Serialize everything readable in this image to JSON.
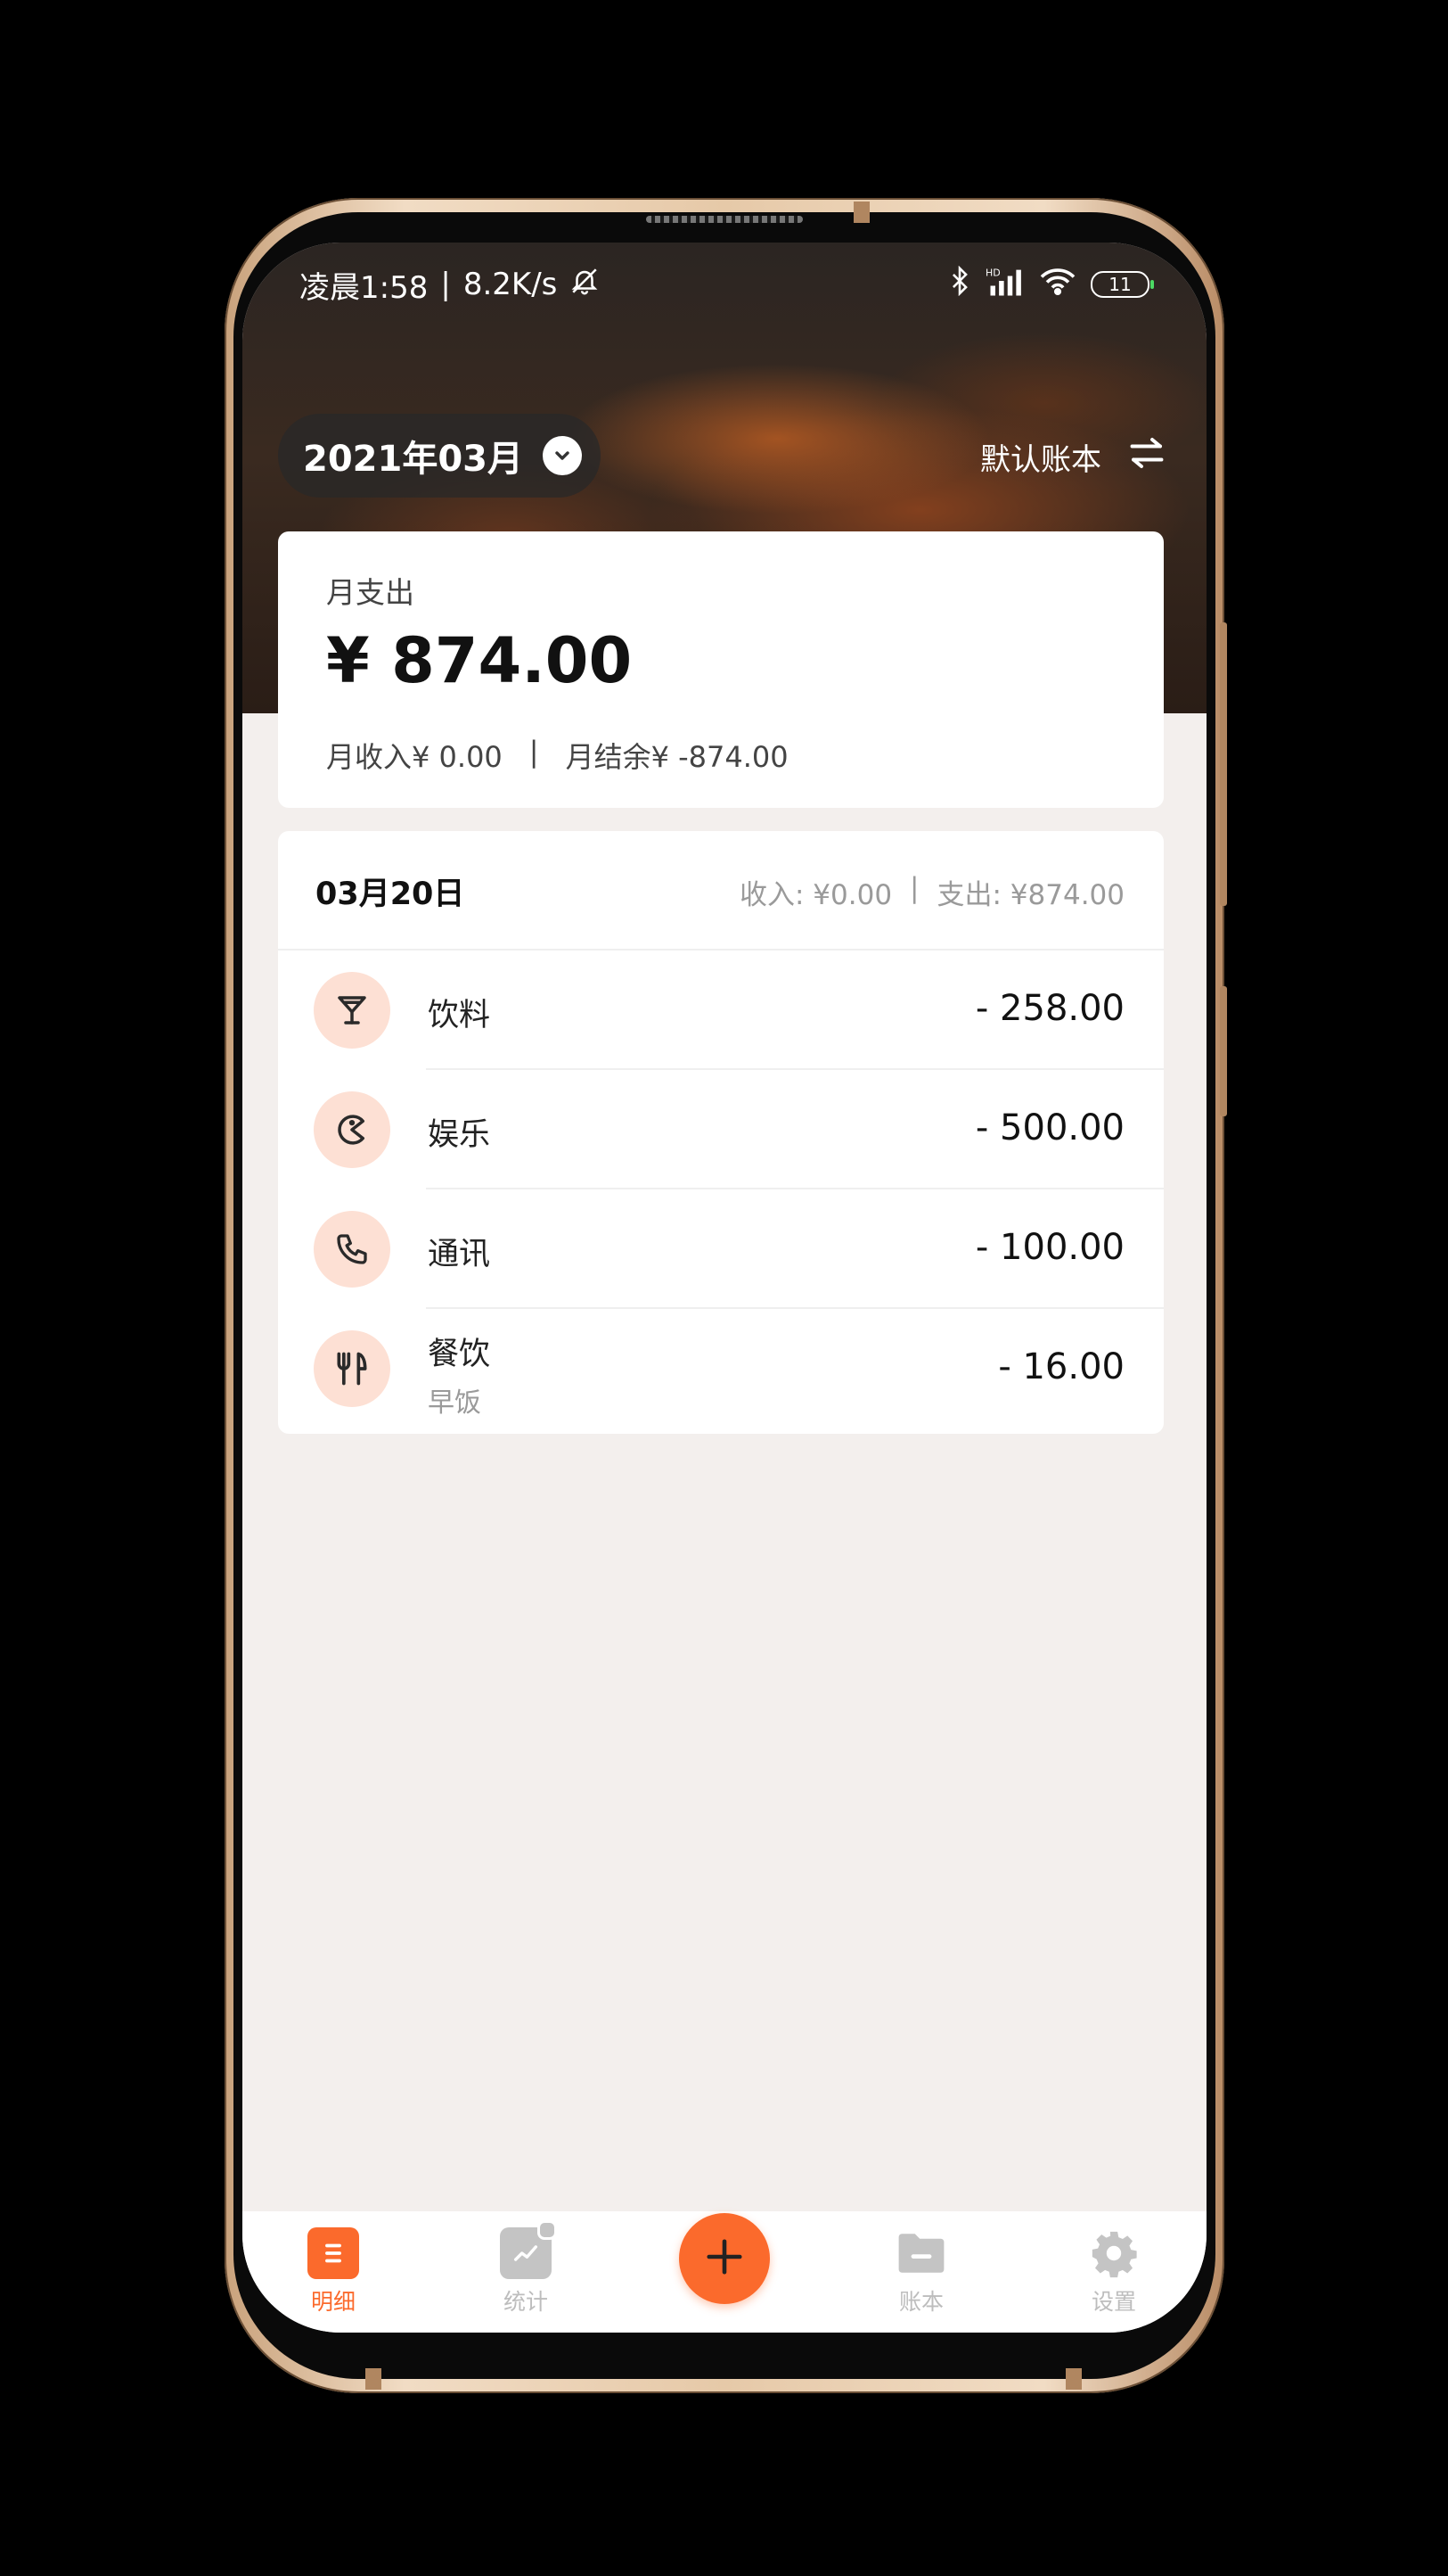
{
  "status_bar": {
    "time": "凌晨1:58",
    "separator": "|",
    "network_speed": "8.2K/s",
    "battery": "11",
    "icons": [
      "mute-bell-icon",
      "bluetooth-icon",
      "hd-signal-icon",
      "wifi-icon",
      "battery-icon"
    ]
  },
  "header": {
    "month": "2021年03月",
    "book_name": "默认账本"
  },
  "summary": {
    "expense_label": "月支出",
    "expense_amount": "¥ 874.00",
    "income": "月收入¥ 0.00",
    "divider": "|",
    "balance": "月结余¥ -874.00"
  },
  "day_group": {
    "date": "03月20日",
    "income": "收入: ¥0.00",
    "divider": "|",
    "expense": "支出: ¥874.00",
    "transactions": [
      {
        "category": "饮料",
        "note": "",
        "amount": "- 258.00",
        "icon": "cocktail-glass-icon"
      },
      {
        "category": "娱乐",
        "note": "",
        "amount": "- 500.00",
        "icon": "pacman-icon"
      },
      {
        "category": "通讯",
        "note": "",
        "amount": "- 100.00",
        "icon": "phone-icon"
      },
      {
        "category": "餐饮",
        "note": "早饭",
        "amount": "- 16.00",
        "icon": "fork-knife-icon"
      }
    ]
  },
  "tabbar": {
    "tabs": [
      {
        "label": "明细",
        "icon": "list-icon",
        "active": true
      },
      {
        "label": "统计",
        "icon": "chart-icon",
        "active": false
      },
      {
        "label": "账本",
        "icon": "folder-icon",
        "active": false
      },
      {
        "label": "设置",
        "icon": "gear-icon",
        "active": false
      }
    ],
    "add_icon": "plus-icon"
  },
  "colors": {
    "accent": "#fb6a2c",
    "icon_bg": "#fde0d4",
    "inactive": "#bdbdbd",
    "frame": "#e6c9a8"
  }
}
